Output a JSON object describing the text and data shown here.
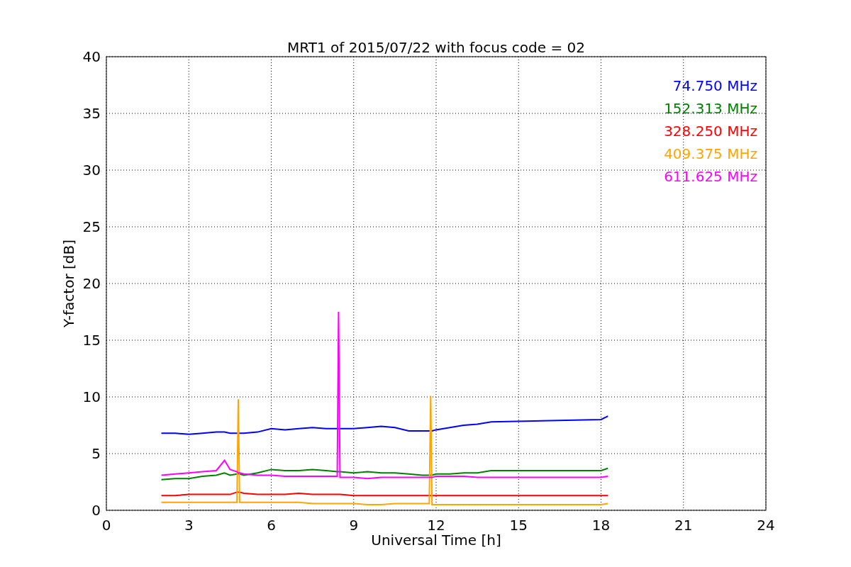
{
  "figure": {
    "chart_data": {
      "type": "line",
      "title": "MRT1 of 2015/07/22 with focus code = 02",
      "xlabel": "Universal Time [h]",
      "ylabel": "Y-factor [dB]",
      "grid": true,
      "x": [
        2,
        2.5,
        3,
        3.5,
        4,
        4.3,
        4.5,
        4.75,
        4.8,
        4.85,
        5,
        5.5,
        6,
        6.5,
        7,
        7.5,
        8,
        8.4,
        8.45,
        8.5,
        9,
        9.5,
        10,
        10.5,
        11,
        11.5,
        11.75,
        11.8,
        11.85,
        12,
        12.5,
        13,
        13.5,
        14,
        18,
        18.25
      ],
      "series": [
        {
          "name": "74.750 MHz",
          "color": "#0000ff",
          "values": [
            6.8,
            6.8,
            6.7,
            6.8,
            6.9,
            6.9,
            6.8,
            6.8,
            6.8,
            6.8,
            6.8,
            6.9,
            7.2,
            7.1,
            7.2,
            7.3,
            7.2,
            7.2,
            7.2,
            7.2,
            7.2,
            7.3,
            7.4,
            7.3,
            7.0,
            7.0,
            7.0,
            7.0,
            7.0,
            7.1,
            7.3,
            7.5,
            7.6,
            7.8,
            8.0,
            8.3
          ]
        },
        {
          "name": "152.313 MHz",
          "color": "#008000",
          "values": [
            2.7,
            2.8,
            2.8,
            3.0,
            3.1,
            3.3,
            3.1,
            3.2,
            3.2,
            3.2,
            3.1,
            3.3,
            3.6,
            3.5,
            3.5,
            3.6,
            3.5,
            3.4,
            3.4,
            3.4,
            3.3,
            3.4,
            3.3,
            3.3,
            3.2,
            3.1,
            3.1,
            3.1,
            3.1,
            3.2,
            3.2,
            3.3,
            3.3,
            3.5,
            3.5,
            3.7
          ]
        },
        {
          "name": "328.250 MHz",
          "color": "#ff0000",
          "values": [
            1.3,
            1.3,
            1.4,
            1.4,
            1.4,
            1.4,
            1.4,
            1.6,
            1.6,
            1.6,
            1.5,
            1.4,
            1.4,
            1.4,
            1.5,
            1.4,
            1.4,
            1.4,
            1.4,
            1.4,
            1.3,
            1.3,
            1.3,
            1.3,
            1.3,
            1.3,
            1.3,
            1.3,
            1.3,
            1.3,
            1.3,
            1.3,
            1.3,
            1.3,
            1.3,
            1.3
          ]
        },
        {
          "name": "409.375 MHz",
          "color": "#ffa500",
          "values": [
            0.7,
            0.7,
            0.7,
            0.7,
            0.7,
            0.7,
            0.7,
            0.7,
            9.8,
            0.7,
            0.7,
            0.7,
            0.7,
            0.7,
            0.7,
            0.6,
            0.6,
            0.6,
            0.6,
            0.6,
            0.6,
            0.5,
            0.5,
            0.6,
            0.6,
            0.6,
            0.6,
            10.1,
            0.5,
            0.5,
            0.5,
            0.5,
            0.5,
            0.5,
            0.5,
            0.6
          ]
        },
        {
          "name": "611.625 MHz",
          "color": "#ff00ff",
          "values": [
            3.1,
            3.2,
            3.3,
            3.4,
            3.5,
            4.4,
            3.6,
            3.4,
            3.3,
            3.3,
            3.2,
            3.1,
            3.1,
            3.0,
            3.0,
            3.0,
            3.0,
            3.0,
            17.5,
            2.9,
            2.9,
            2.8,
            2.9,
            2.9,
            2.9,
            2.9,
            2.9,
            2.9,
            2.9,
            3.0,
            3.0,
            3.0,
            2.9,
            2.9,
            2.9,
            3.0
          ]
        }
      ],
      "xlim": [
        0,
        24
      ],
      "ylim": [
        0,
        40
      ],
      "xticks": [
        0,
        3,
        6,
        9,
        12,
        15,
        18,
        21,
        24
      ],
      "yticks": [
        0,
        5,
        10,
        15,
        20,
        25,
        30,
        35,
        40
      ]
    }
  }
}
